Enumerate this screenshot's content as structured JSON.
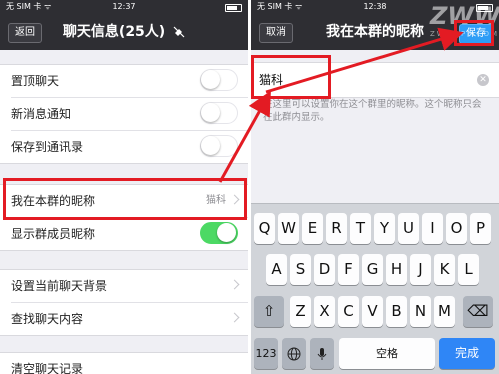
{
  "left": {
    "status": {
      "carrier": "无 SIM 卡 ᯤ",
      "time": "12:37"
    },
    "nav": {
      "back": "返回",
      "title": "聊天信息(25人)"
    },
    "group1": [
      {
        "label": "置顶聊天",
        "switch_on": false
      },
      {
        "label": "新消息通知",
        "switch_on": false
      },
      {
        "label": "保存到通讯录",
        "switch_on": false
      }
    ],
    "group2": [
      {
        "label": "我在本群的昵称",
        "value": "猫科"
      },
      {
        "label": "显示群成员昵称",
        "switch_on": true
      }
    ],
    "group3": [
      {
        "label": "设置当前聊天背景"
      },
      {
        "label": "查找聊天内容"
      }
    ],
    "group4": [
      {
        "label": "清空聊天记录"
      }
    ]
  },
  "right": {
    "status": {
      "carrier": "无 SIM 卡 ᯤ",
      "time": "12:38"
    },
    "nav": {
      "cancel": "取消",
      "title": "我在本群的昵称",
      "save": "保存"
    },
    "input": {
      "value": "猫科",
      "clear": "✕"
    },
    "hint": "在这里可以设置你在这个群里的昵称。这个昵称只会在此群内显示。",
    "keyboard": {
      "row1": [
        "Q",
        "W",
        "E",
        "R",
        "T",
        "Y",
        "U",
        "I",
        "O",
        "P"
      ],
      "row2": [
        "A",
        "S",
        "D",
        "F",
        "G",
        "H",
        "J",
        "K",
        "L"
      ],
      "row3": [
        "Z",
        "X",
        "C",
        "V",
        "B",
        "N",
        "M"
      ],
      "shift": "⇧",
      "backspace": "⌫",
      "num": "123",
      "globe": "🌐",
      "mic": "🎤",
      "space": "空格",
      "done": "完成"
    }
  },
  "watermark": {
    "text": "ZWW",
    "sub": "ZWWAPP.COM"
  },
  "colors": {
    "navbar": "#2e2e33",
    "accent": "#2e9df6",
    "switch_on": "#4cd964",
    "highlight": "#e31b23"
  }
}
